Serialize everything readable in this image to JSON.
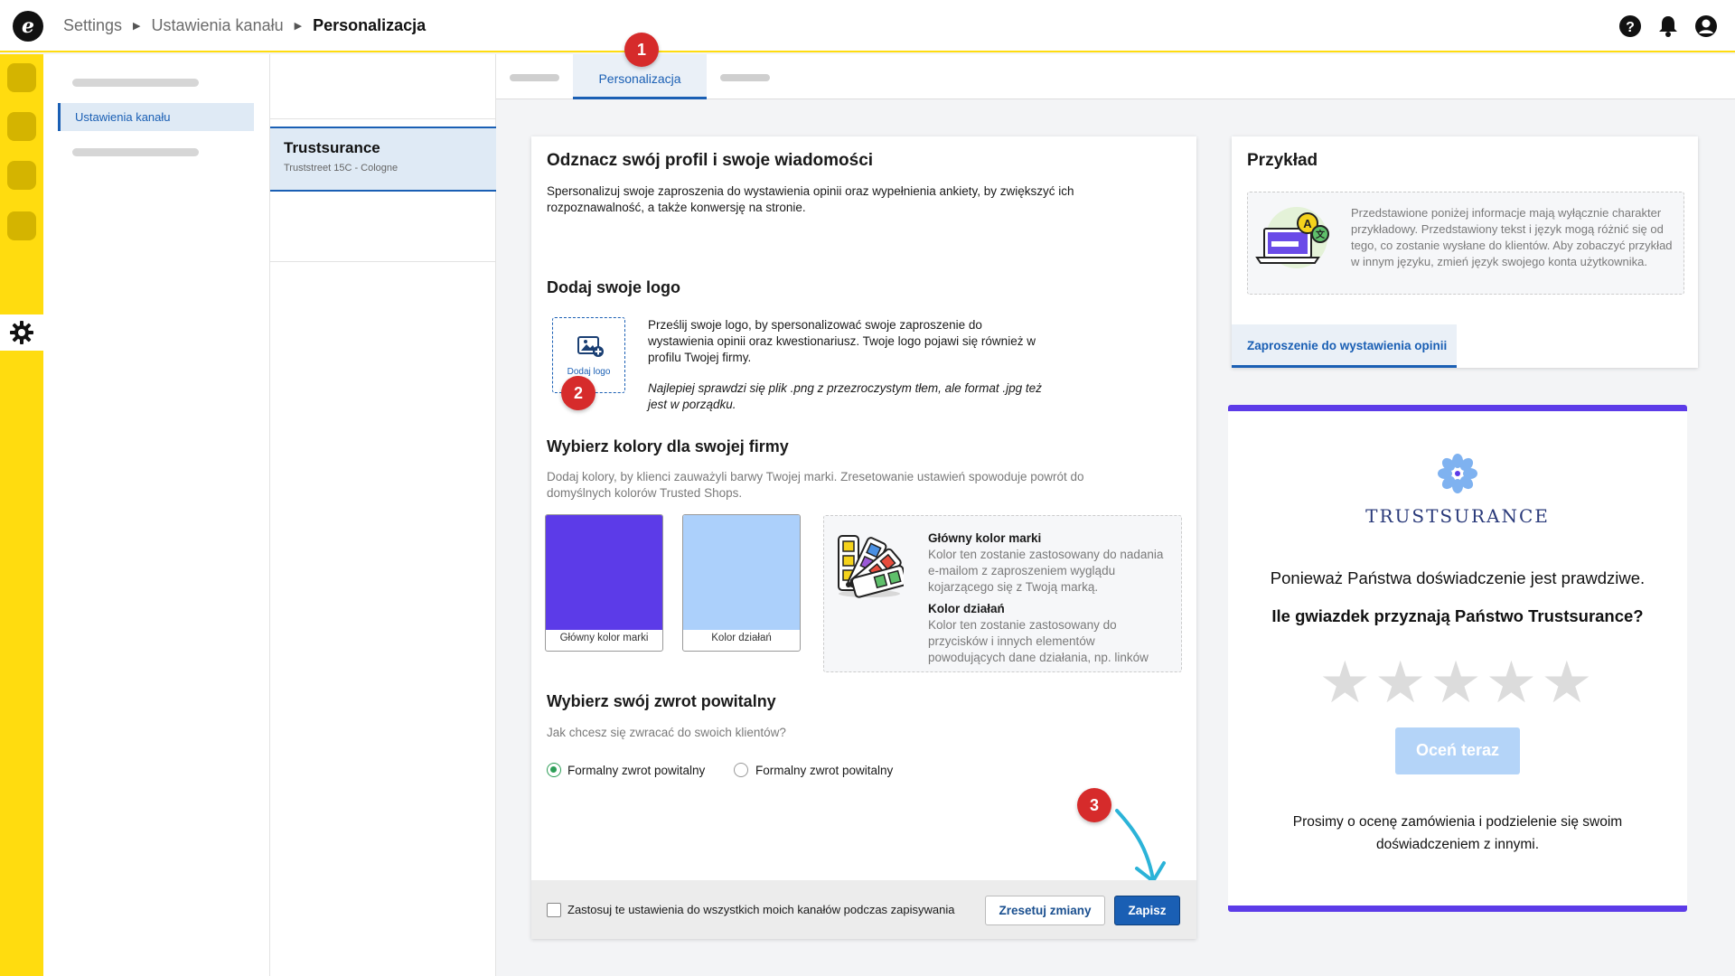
{
  "header": {
    "logo_letter": "e",
    "breadcrumb": [
      "Settings",
      "Ustawienia kanału",
      "Personalizacja"
    ]
  },
  "subsidebar": {
    "active_item": "Ustawienia kanału"
  },
  "channel": {
    "name": "Trustsurance",
    "address": "Truststreet 15C - Cologne"
  },
  "tabs": {
    "active": "Personalizacja"
  },
  "badges": [
    "1",
    "2",
    "3"
  ],
  "main": {
    "title": "Odznacz swój profil i swoje wiadomości",
    "intro": "Spersonalizuj swoje zaproszenia do wystawienia opinii oraz wypełnienia ankiety, by zwiększyć ich rozpoznawalność, a także konwersję na stronie.",
    "logo": {
      "heading": "Dodaj swoje logo",
      "add_label": "Dodaj logo",
      "description": "Prześlij swoje logo, by spersonalizować swoje zaproszenie do wystawienia opinii oraz kwestionariusz. Twoje logo pojawi się również w profilu Twojej firmy.",
      "hint": "Najlepiej sprawdzi się plik .png z przezroczystym tłem, ale format .jpg też jest w porządku."
    },
    "colors": {
      "heading": "Wybierz kolory dla swojej firmy",
      "description": "Dodaj kolory, by klienci zauważyli barwy Twojej marki. Zresetowanie ustawień spowoduje powrót do domyślnych kolorów Trusted Shops.",
      "brand_label": "Główny kolor marki",
      "brand_color": "#5c3be8",
      "action_label": "Kolor działań",
      "action_color": "#acd0fb",
      "info_brand_title": "Główny kolor marki",
      "info_brand_text": "Kolor ten zostanie zastosowany do nadania e-mailom z zaproszeniem wyglądu kojarzącego się z Twoją marką.",
      "info_action_title": "Kolor działań",
      "info_action_text": "Kolor ten zostanie zastosowany do przycisków i innych elementów powodujących dane działania, np. linków"
    },
    "greeting": {
      "heading": "Wybierz swój zwrot powitalny",
      "question": "Jak chcesz się zwracać do swoich klientów?",
      "option1": "Formalny zwrot powitalny",
      "option2": "Formalny zwrot powitalny"
    },
    "footer": {
      "apply_all": "Zastosuj te ustawienia do wszystkich moich kanałów podczas zapisywania",
      "reset": "Zresetuj zmiany",
      "save": "Zapisz"
    }
  },
  "example": {
    "title": "Przykład",
    "info": "Przedstawione poniżej informacje mają wyłącznie charakter przykładowy. Przedstawiony tekst i język mogą różnić się od tego, co zostanie wysłane do klientów. Aby zobaczyć przykład w innym języku, zmień język swojego konta użytkownika.",
    "tab": "Zaproszenie do wystawienia opinii"
  },
  "preview": {
    "brand": "TRUSTSURANCE",
    "line1": "Ponieważ Państwa doświadczenie jest prawdziwe.",
    "line2": "Ile gwiazdek przyznają Państwo Trustsurance?",
    "stars": "★★★★★",
    "button": "Oceń teraz",
    "footer": "Prosimy o ocenę zamówienia i podzielenie się swoim doświadczeniem z innymi."
  }
}
